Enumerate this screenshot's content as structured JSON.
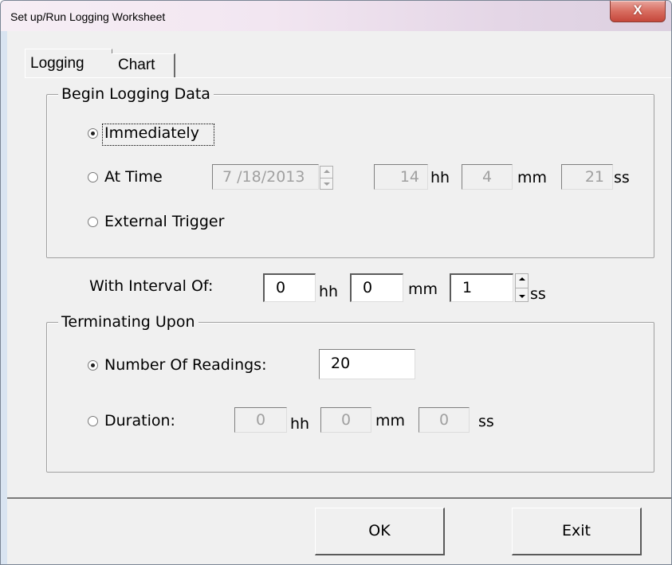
{
  "window": {
    "title": "Set up/Run Logging Worksheet",
    "close_glyph": "X"
  },
  "tabs": [
    {
      "label": "Logging",
      "active": true
    },
    {
      "label": "Chart",
      "active": false
    }
  ],
  "begin_group": {
    "legend": "Begin Logging Data",
    "options": {
      "immediately": "Immediately",
      "at_time": "At Time",
      "external_trigger": "External Trigger"
    },
    "selected": "Immediately",
    "at_time": {
      "date": "7 /18/2013",
      "hh": "14",
      "mm": "4",
      "ss": "21"
    }
  },
  "interval": {
    "label": "With Interval Of:",
    "hh": "0",
    "mm": "0",
    "ss": "1"
  },
  "units": {
    "hh": "hh",
    "mm": "mm",
    "ss": "ss"
  },
  "terminate_group": {
    "legend": "Terminating Upon",
    "options": {
      "number_of_readings": "Number Of Readings:",
      "duration": "Duration:"
    },
    "selected": "Number Of Readings:",
    "readings": "20",
    "duration": {
      "hh": "0",
      "mm": "0",
      "ss": "0"
    }
  },
  "buttons": {
    "ok": "OK",
    "exit": "Exit"
  }
}
